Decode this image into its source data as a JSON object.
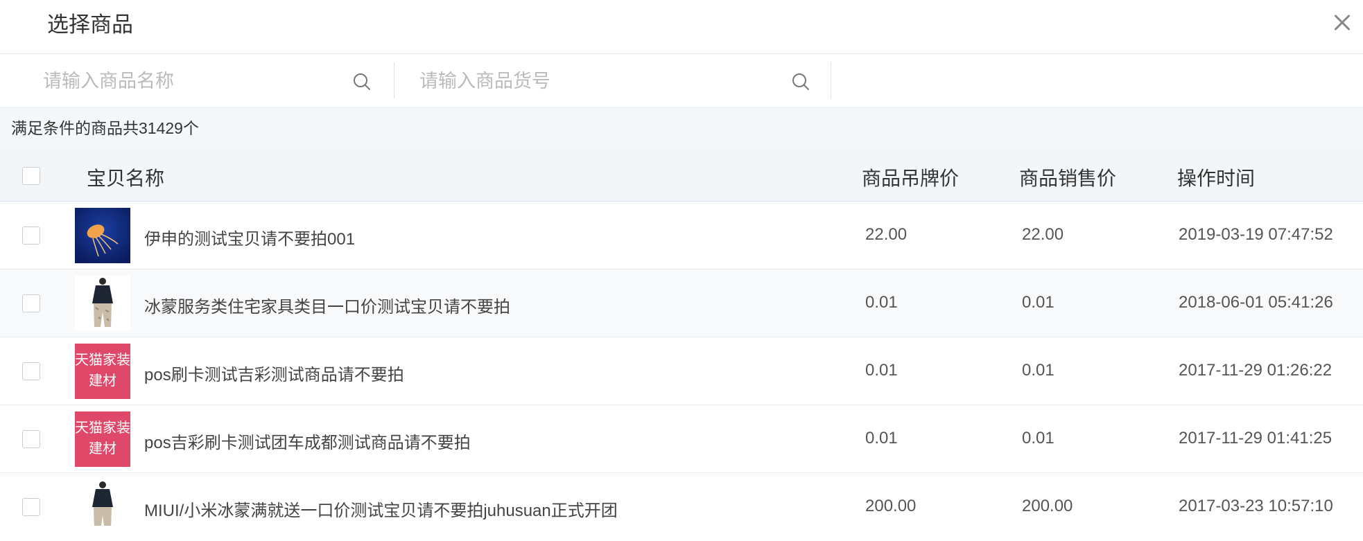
{
  "dialog": {
    "title": "选择商品"
  },
  "search": {
    "name_placeholder": "请输入商品名称",
    "sku_placeholder": "请输入商品货号"
  },
  "summary": {
    "text": "满足条件的商品共31429个"
  },
  "table": {
    "columns": {
      "name": "宝贝名称",
      "tag_price": "商品吊牌价",
      "sale_price": "商品销售价",
      "time": "操作时间"
    },
    "rows": [
      {
        "name": "伊申的测试宝贝请不要拍001",
        "tag_price": "22.00",
        "sale_price": "22.00",
        "time": "2019-03-19 07:47:52",
        "thumb": "jellyfish-photo"
      },
      {
        "name": "冰蒙服务类住宅家具类目一口价测试宝贝请不要拍",
        "tag_price": "0.01",
        "sale_price": "0.01",
        "time": "2018-06-01 05:41:26",
        "thumb": "model-photo"
      },
      {
        "name": "pos刷卡测试吉彩测试商品请不要拍",
        "tag_price": "0.01",
        "sale_price": "0.01",
        "time": "2017-11-29 01:26:22",
        "thumb": "tmall-badge",
        "thumb_line1": "天猫家装",
        "thumb_line2": "建材"
      },
      {
        "name": "pos吉彩刷卡测试团车成都测试商品请不要拍",
        "tag_price": "0.01",
        "sale_price": "0.01",
        "time": "2017-11-29 01:41:25",
        "thumb": "tmall-badge",
        "thumb_line1": "天猫家装",
        "thumb_line2": "建材"
      },
      {
        "name": "MIUI/小米冰蒙满就送一口价测试宝贝请不要拍juhusuan正式开团",
        "tag_price": "200.00",
        "sale_price": "200.00",
        "time": "2017-03-23 10:57:10",
        "thumb": "model-photo"
      }
    ]
  },
  "colors": {
    "tmall_badge": "#e0486a",
    "header_bg": "#f3f6f9",
    "summary_bg": "#f5f8fb"
  }
}
